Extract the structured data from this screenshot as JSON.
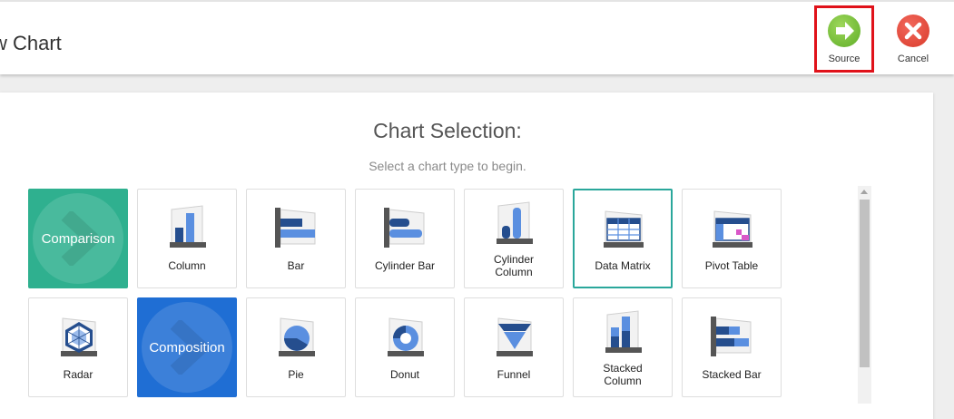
{
  "header": {
    "title": "w Chart",
    "source_label": "Source",
    "cancel_label": "Cancel"
  },
  "selection": {
    "title": "Chart Selection:",
    "subtitle": "Select a chart type to begin."
  },
  "categories": {
    "comparison": {
      "label": "Comparison",
      "color": "#2fb08f"
    },
    "composition": {
      "label": "Composition",
      "color": "#1f6ed4"
    }
  },
  "tiles": {
    "column": "Column",
    "bar": "Bar",
    "cylinder_bar": "Cylinder Bar",
    "cylinder_column_1": "Cylinder",
    "cylinder_column_2": "Column",
    "data_matrix": "Data Matrix",
    "pivot_table": "Pivot Table",
    "radar": "Radar",
    "pie": "Pie",
    "donut": "Donut",
    "funnel": "Funnel",
    "stacked_column_1": "Stacked",
    "stacked_column_2": "Column",
    "stacked_bar": "Stacked Bar"
  },
  "selected_tile": "Data Matrix"
}
